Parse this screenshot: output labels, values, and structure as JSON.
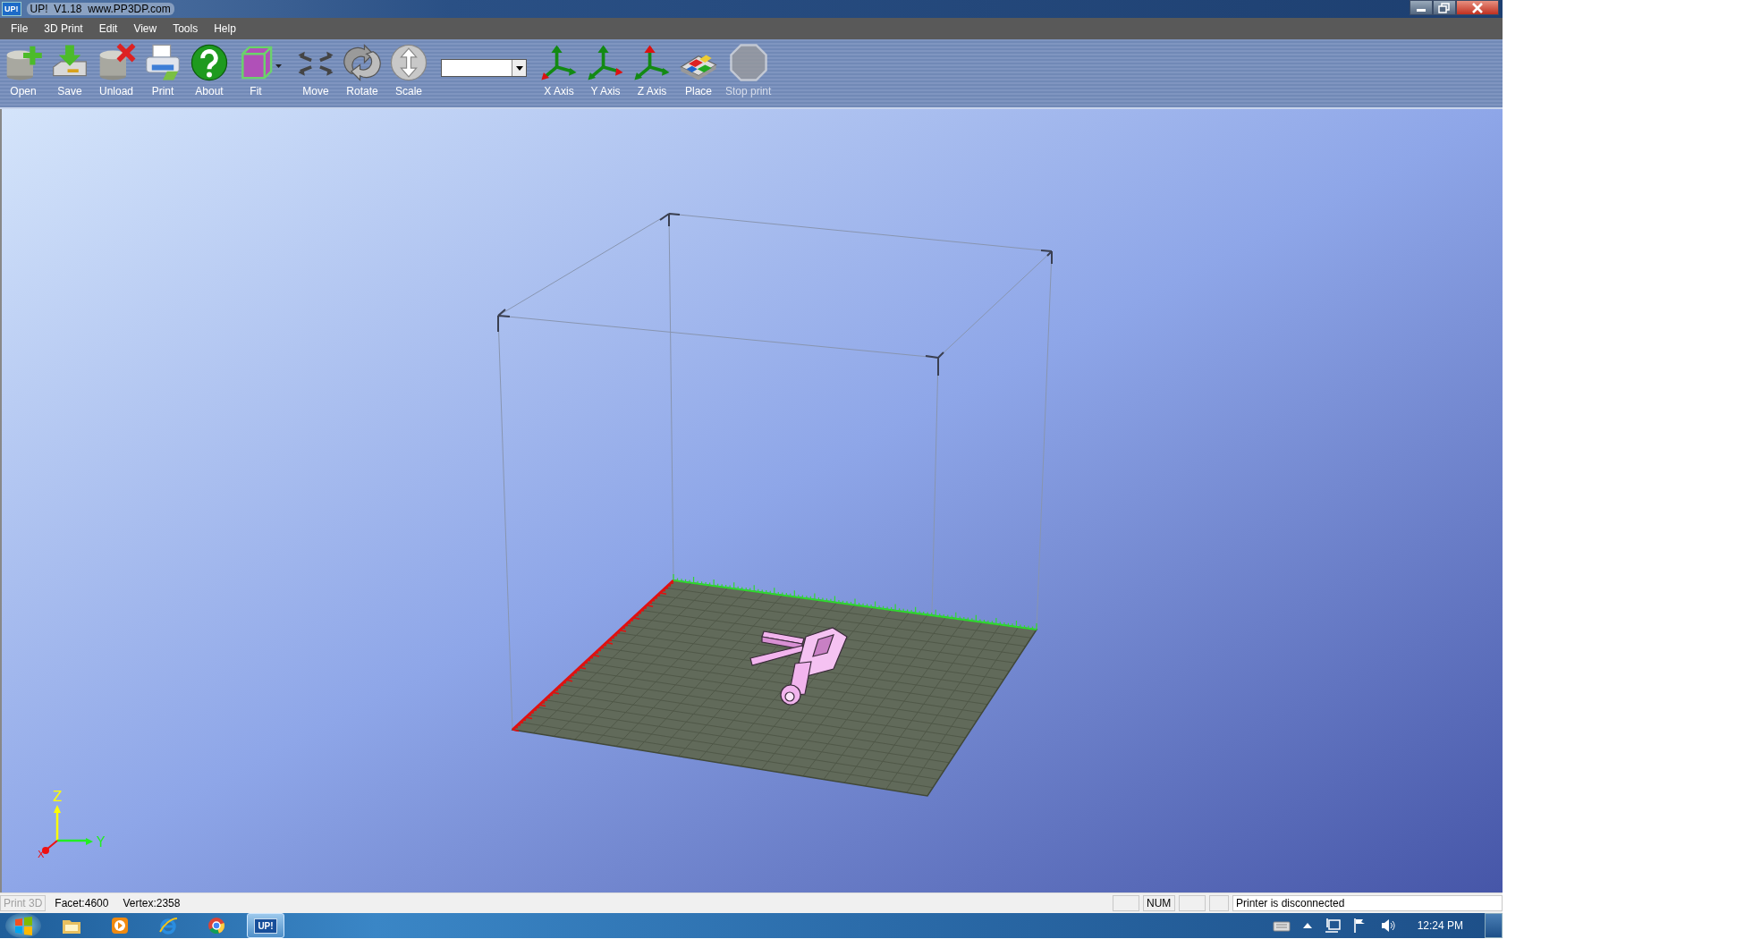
{
  "window": {
    "title": "UP!  V1.18  www.PP3DP.com",
    "app_badge": "UP!"
  },
  "menu": [
    {
      "label": "File"
    },
    {
      "label": "3D Print"
    },
    {
      "label": "Edit"
    },
    {
      "label": "View"
    },
    {
      "label": "Tools"
    },
    {
      "label": "Help"
    }
  ],
  "toolbar": [
    {
      "label": "Open",
      "kind": "open",
      "disabled": false
    },
    {
      "label": "Save",
      "kind": "save",
      "disabled": false
    },
    {
      "label": "Unload",
      "kind": "unload",
      "disabled": false
    },
    {
      "label": "Print",
      "kind": "print",
      "disabled": false
    },
    {
      "label": "About",
      "kind": "about",
      "disabled": false
    },
    {
      "label": "Fit",
      "kind": "fit",
      "disabled": false,
      "dropdown": true
    },
    {
      "label": "Move",
      "kind": "move",
      "disabled": false
    },
    {
      "label": "Rotate",
      "kind": "rotate",
      "disabled": false
    },
    {
      "label": "Scale",
      "kind": "scale",
      "disabled": false
    },
    {
      "kind": "combo"
    },
    {
      "label": "X Axis",
      "kind": "xaxis",
      "disabled": false
    },
    {
      "label": "Y Axis",
      "kind": "yaxis",
      "disabled": false
    },
    {
      "label": "Z Axis",
      "kind": "zaxis",
      "disabled": false
    },
    {
      "label": "Place",
      "kind": "place",
      "disabled": false
    },
    {
      "label": "Stop print",
      "kind": "stop",
      "disabled": true
    }
  ],
  "viewport": {
    "gizmo": {
      "z": "Z",
      "y": "Y",
      "x": "X"
    }
  },
  "status_bar": {
    "mode": {
      "text": "Print 3D",
      "disabled": true
    },
    "facet": "Facet:4600",
    "vertex": "Vertex:2358",
    "indicator": "NUM",
    "message": "Printer is disconnected"
  },
  "taskbar": {
    "apps": [
      {
        "kind": "folder",
        "selected": false
      },
      {
        "kind": "media",
        "selected": false
      },
      {
        "kind": "ie",
        "selected": false
      },
      {
        "kind": "chrome",
        "selected": false
      },
      {
        "kind": "up",
        "label": "UP!",
        "selected": true
      }
    ],
    "clock": "12:24 PM"
  }
}
